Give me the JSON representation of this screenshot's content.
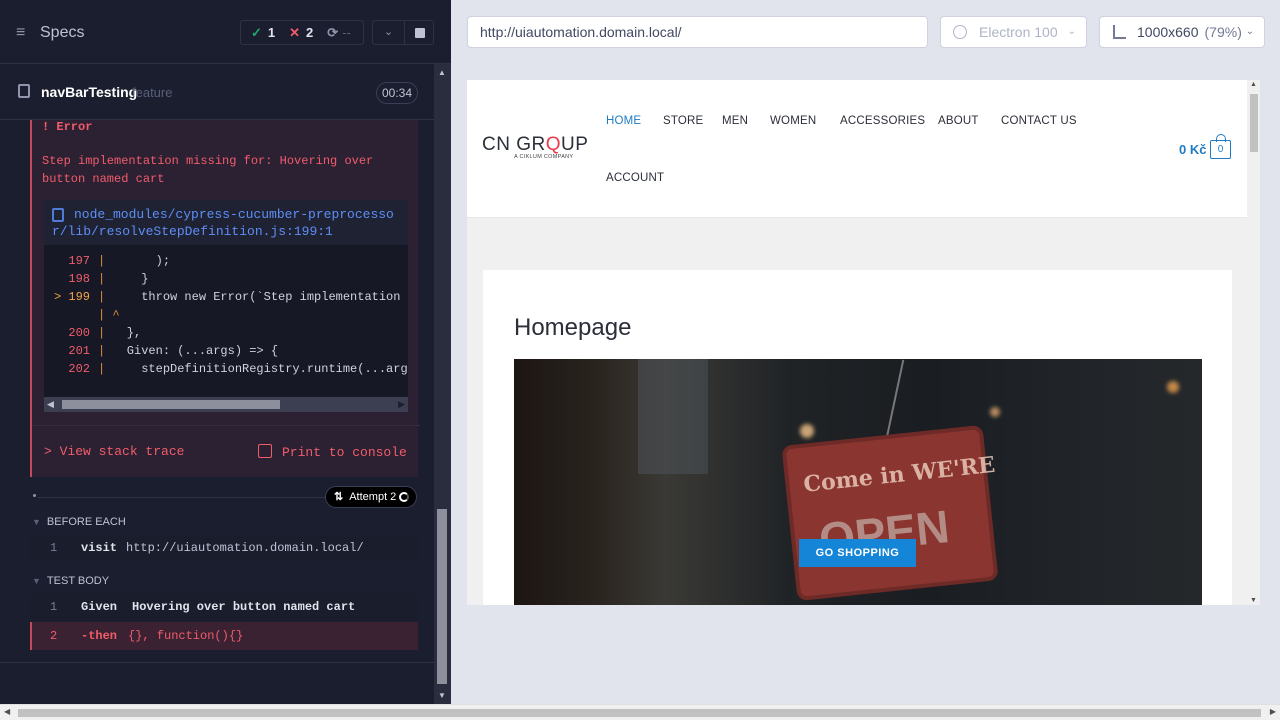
{
  "runner": {
    "specs_title": "Specs",
    "stats": {
      "passed": "1",
      "failed": "2",
      "pending": "--"
    },
    "spec": {
      "name": "navBarTesting",
      "ext": "feature",
      "duration": "00:34"
    },
    "error": {
      "title": "! Error",
      "message": "Step implementation missing for: Hovering over button named cart",
      "file_path": "node_modules/cypress-cucumber-preprocessor/lib/resolveStepDefinition.js:199:1",
      "code_lines": [
        {
          "num": "197",
          "marker": "",
          "text": "      );"
        },
        {
          "num": "198",
          "marker": "",
          "text": "    }"
        },
        {
          "num": "199",
          "marker": ">",
          "text": "    throw new Error(`Step implementation m"
        },
        {
          "num": "",
          "marker": "",
          "text": "^"
        },
        {
          "num": "200",
          "marker": "",
          "text": "  },"
        },
        {
          "num": "201",
          "marker": "",
          "text": "  Given: (...args) => {"
        },
        {
          "num": "202",
          "marker": "",
          "text": "    stepDefinitionRegistry.runtime(...args"
        }
      ],
      "view_stack_label": "> View stack trace",
      "print_console_label": "Print to console"
    },
    "attempt_label": "Attempt 2",
    "before_each": {
      "heading": "BEFORE EACH",
      "commands": [
        {
          "num": "1",
          "name": "visit",
          "message": "http://uiautomation.domain.local/"
        }
      ]
    },
    "test_body": {
      "heading": "TEST BODY",
      "commands": [
        {
          "num": "1",
          "name": "Given",
          "message": "Hovering over button named cart"
        },
        {
          "num": "2",
          "name": "-then",
          "message": "{}, function(){}"
        }
      ]
    }
  },
  "aut": {
    "url": "http://uiautomation.domain.local/",
    "browser": "Electron 100",
    "viewport": "1000x660",
    "scale": "(79%)",
    "site": {
      "logo_main": "CN GR",
      "logo_q": "Q",
      "logo_end": "UP",
      "logo_sub": "A CIKLUM COMPANY",
      "nav": [
        "HOME",
        "STORE",
        "MEN",
        "WOMEN",
        "ACCESSORIES",
        "ABOUT",
        "CONTACT US",
        "ACCOUNT"
      ],
      "cart_amount": "0 Kč",
      "cart_count": "0",
      "page_heading": "Homepage",
      "hero_sign_text": "Come in WE'RE",
      "hero_sign_big": "OPEN",
      "cta_label": "GO SHOPPING"
    }
  },
  "colors": {
    "accent": "#1f7bc2",
    "fail": "#f15c6b",
    "pass": "#1fa971",
    "cta": "#1585d8"
  },
  "icons": [
    "specs-icon",
    "check-icon",
    "x-icon",
    "spinner-icon",
    "chevron-down-icon",
    "stop-icon",
    "file-icon",
    "print-icon",
    "browser-icon",
    "ruler-icon",
    "cart-bag-icon"
  ]
}
